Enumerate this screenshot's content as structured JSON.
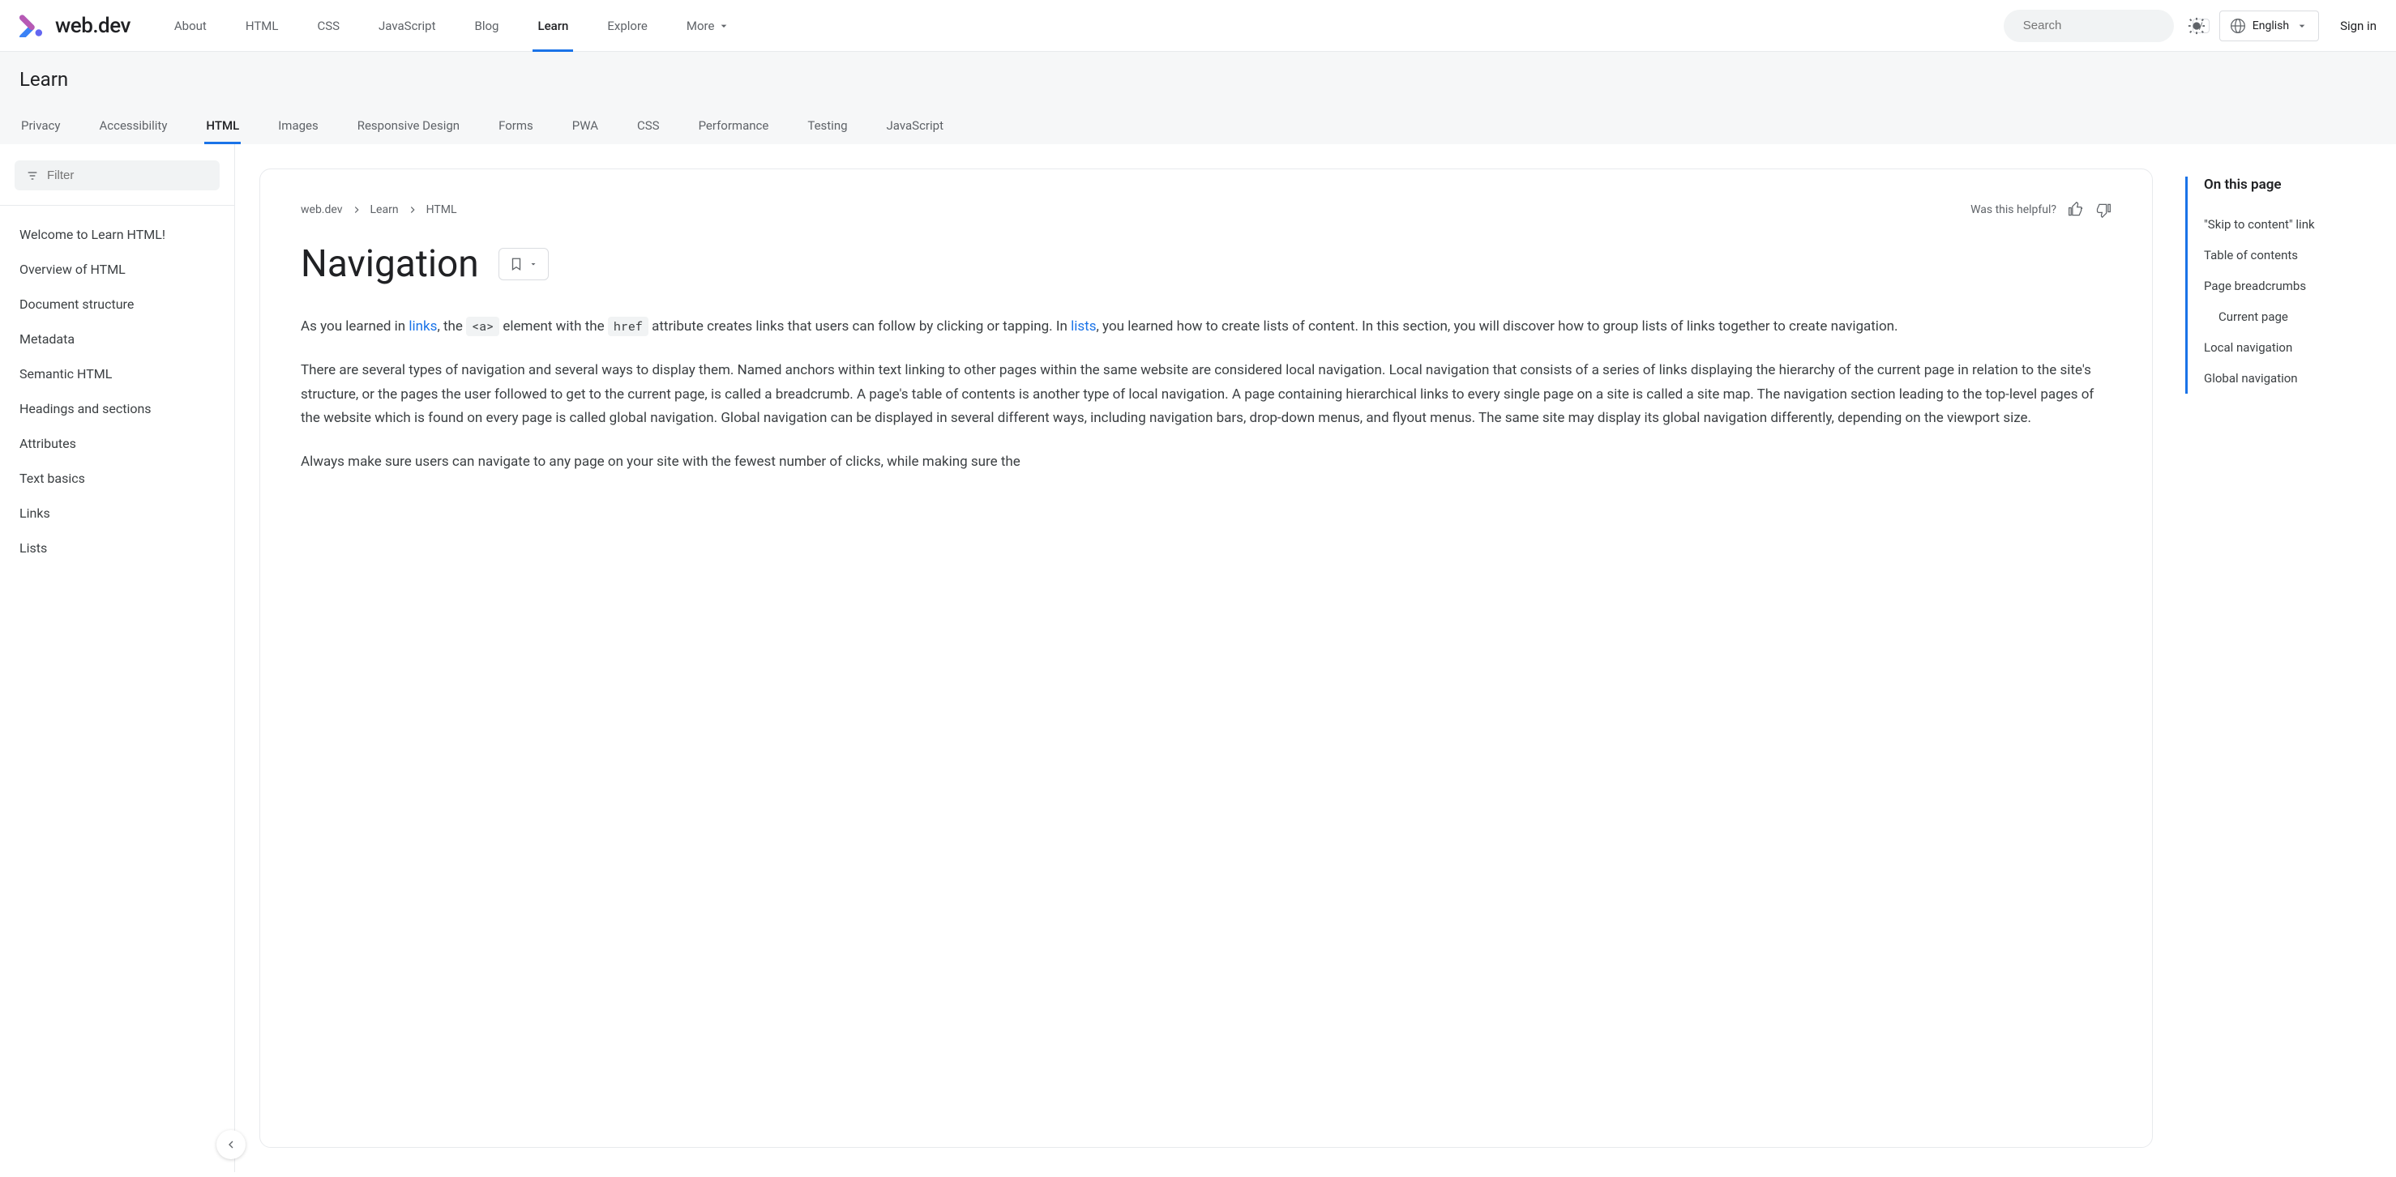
{
  "site": {
    "name": "web.dev"
  },
  "top_nav": {
    "items": [
      "About",
      "HTML",
      "CSS",
      "JavaScript",
      "Blog",
      "Learn",
      "Explore",
      "More"
    ],
    "active_index": 5
  },
  "search": {
    "placeholder": "Search",
    "shortcut": "/"
  },
  "language": {
    "label": "English"
  },
  "signin": "Sign in",
  "subheader": {
    "title": "Learn",
    "tabs": [
      "Privacy",
      "Accessibility",
      "HTML",
      "Images",
      "Responsive Design",
      "Forms",
      "PWA",
      "CSS",
      "Performance",
      "Testing",
      "JavaScript"
    ],
    "active_index": 2
  },
  "sidebar": {
    "filter_placeholder": "Filter",
    "items": [
      "Welcome to Learn HTML!",
      "Overview of HTML",
      "Document structure",
      "Metadata",
      "Semantic HTML",
      "Headings and sections",
      "Attributes",
      "Text basics",
      "Links",
      "Lists"
    ]
  },
  "breadcrumbs": [
    "web.dev",
    "Learn",
    "HTML"
  ],
  "helpful": {
    "label": "Was this helpful?"
  },
  "page": {
    "title": "Navigation"
  },
  "article": {
    "p1_part1": "As you learned in ",
    "p1_link1": "links",
    "p1_part2": ", the ",
    "p1_code1": "<a>",
    "p1_part3": " element with the ",
    "p1_code2": "href",
    "p1_part4": " attribute creates links that users can follow by clicking or tapping. In ",
    "p1_link2": "lists",
    "p1_part5": ", you learned how to create lists of content. In this section, you will discover how to group lists of links together to create navigation.",
    "p2": "There are several types of navigation and several ways to display them. Named anchors within text linking to other pages within the same website are considered local navigation. Local navigation that consists of a series of links displaying the hierarchy of the current page in relation to the site's structure, or the pages the user followed to get to the current page, is called a breadcrumb. A page's table of contents is another type of local navigation. A page containing hierarchical links to every single page on a site is called a site map. The navigation section leading to the top-level pages of the website which is found on every page is called global navigation. Global navigation can be displayed in several different ways, including navigation bars, drop-down menus, and flyout menus. The same site may display its global navigation differently, depending on the viewport size.",
    "p3": "Always make sure users can navigate to any page on your site with the fewest number of clicks, while making sure the"
  },
  "toc": {
    "title": "On this page",
    "items": [
      {
        "label": "\"Skip to content\" link",
        "indent": false
      },
      {
        "label": "Table of contents",
        "indent": false
      },
      {
        "label": "Page breadcrumbs",
        "indent": false
      },
      {
        "label": "Current page",
        "indent": true
      },
      {
        "label": "Local navigation",
        "indent": false
      },
      {
        "label": "Global navigation",
        "indent": false
      }
    ]
  }
}
